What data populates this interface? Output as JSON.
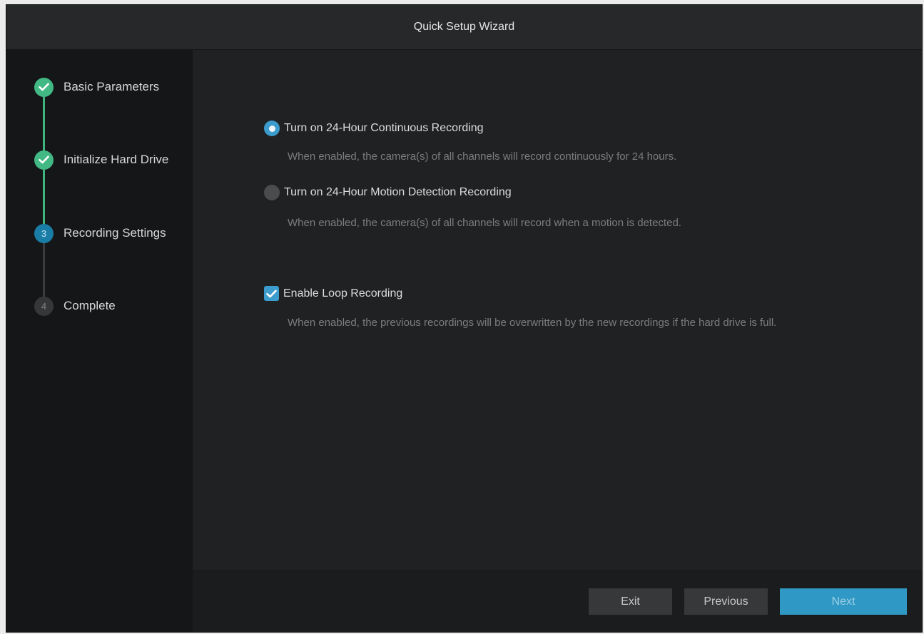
{
  "window": {
    "title": "Quick Setup Wizard"
  },
  "steps": [
    {
      "number": "",
      "label": "Basic Parameters",
      "status": "done",
      "icon": "check-icon"
    },
    {
      "number": "",
      "label": "Initialize Hard Drive",
      "status": "done",
      "icon": "check-icon"
    },
    {
      "number": "3",
      "label": "Recording Settings",
      "status": "current"
    },
    {
      "number": "4",
      "label": "Complete",
      "status": "todo"
    }
  ],
  "options": {
    "continuous": {
      "label": "Turn on 24-Hour Continuous Recording",
      "description": "When enabled, the camera(s) of all channels will record continuously for 24 hours.",
      "selected": true
    },
    "motion": {
      "label": "Turn on 24-Hour Motion Detection Recording",
      "description": "When enabled, the camera(s) of all channels will record when a motion is detected.",
      "selected": false
    },
    "loop": {
      "label": "Enable Loop Recording",
      "description": "When enabled, the previous recordings will be overwritten by the new recordings if the hard drive is full.",
      "checked": true
    }
  },
  "buttons": {
    "exit": "Exit",
    "previous": "Previous",
    "next": "Next"
  },
  "colors": {
    "done": "#42b985",
    "current": "#1a7da6",
    "accent": "#3c9ccd",
    "next_button": "#2f98c4"
  }
}
